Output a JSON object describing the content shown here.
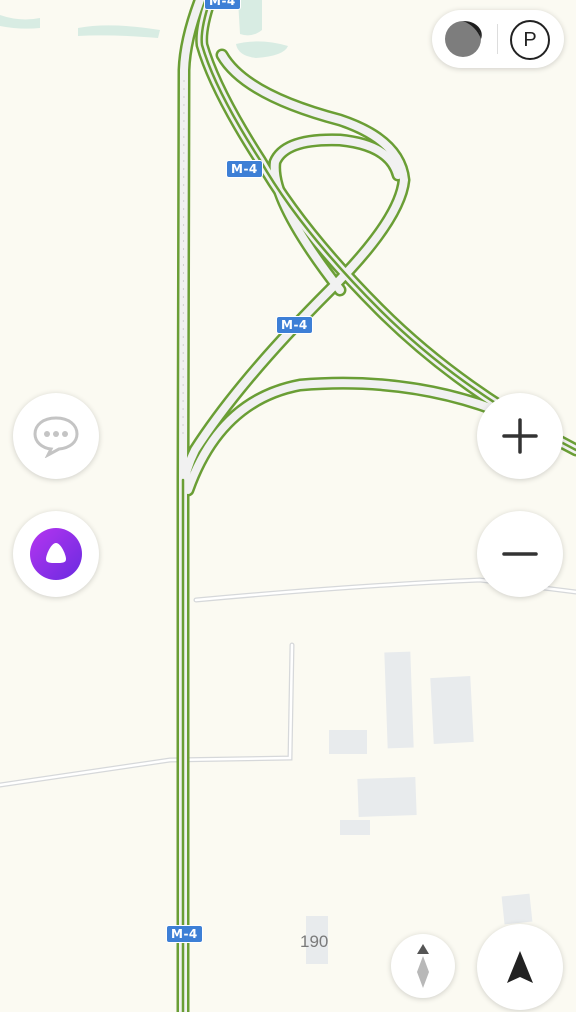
{
  "map": {
    "road_shields": [
      {
        "id": "top",
        "label": "M-4"
      },
      {
        "id": "upper",
        "label": "M-4"
      },
      {
        "id": "middle",
        "label": "M-4"
      },
      {
        "id": "bottom",
        "label": "M-4"
      }
    ],
    "distance_marker": "190",
    "colors": {
      "background": "#fbfaf2",
      "highway_outline": "#6a9e35",
      "highway_fill": "#ededed",
      "shield": "#3d7fd6",
      "minor_road": "#d8dadc",
      "building": "#e8ebed",
      "water": "#d8ece3"
    }
  },
  "controls": {
    "traffic_icon": "traffic-toggle-icon",
    "parking_label": "P",
    "chat_icon": "chat-bubble-icon",
    "assistant_icon": "alice-voice-assistant-icon",
    "zoom_in_icon": "plus-icon",
    "zoom_out_icon": "minus-icon",
    "compass_icon": "compass-icon",
    "locate_icon": "navigation-arrow-icon",
    "assistant_color": "#8a2be2"
  }
}
